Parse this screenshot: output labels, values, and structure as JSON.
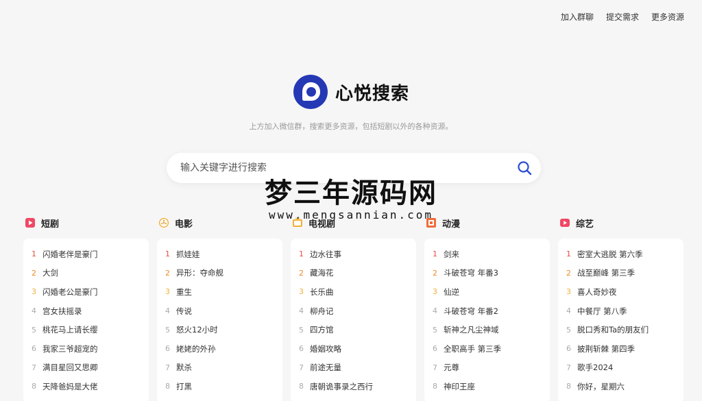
{
  "topnav": [
    "加入群聊",
    "提交需求",
    "更多资源"
  ],
  "logo": {
    "name": "心悦搜索",
    "color": "#2539b5"
  },
  "subtitle": "上方加入微信群，搜索更多资源，包括短剧以外的各种资源。",
  "search": {
    "placeholder": "输入关键字进行搜索",
    "icon": "search-icon",
    "icon_color": "#2b4bd4"
  },
  "watermark": {
    "main": "梦三年源码网",
    "url": "www.mengsannian.com"
  },
  "columns": [
    {
      "title": "短剧",
      "icon": "play-icon",
      "color": "#f04864",
      "items": [
        "闪婚老伴是豪门",
        "大剑",
        "闪婚老公是豪门",
        "宫女扶摇录",
        "桃花马上请长缨",
        "我家三爷超宠的",
        "满目星回又思卿",
        "天降爸妈是大佬"
      ]
    },
    {
      "title": "电影",
      "icon": "film-reel-icon",
      "color": "#f2b035",
      "items": [
        "抓娃娃",
        "异形：夺命舰",
        "重生",
        "传说",
        "怒火12小时",
        "姥姥的外孙",
        "默杀",
        "打黑"
      ]
    },
    {
      "title": "电视剧",
      "icon": "tv-icon",
      "color": "#f2b035",
      "items": [
        "边水往事",
        "藏海花",
        "长乐曲",
        "柳舟记",
        "四方馆",
        "婚姻攻略",
        "前途无量",
        "唐朝诡事录之西行"
      ]
    },
    {
      "title": "动漫",
      "icon": "anime-icon",
      "color": "#f26b3a",
      "items": [
        "剑来",
        "斗破苍穹 年番3",
        "仙逆",
        "斗破苍穹 年番2",
        "斩神之凡尘神域",
        "全职高手 第三季",
        "元尊",
        "神印王座"
      ]
    },
    {
      "title": "综艺",
      "icon": "variety-play-icon",
      "color": "#f04864",
      "items": [
        "密室大逃脱 第六季",
        "战至巅峰 第三季",
        "喜人奇妙夜",
        "中餐厅 第八季",
        "脱口秀和Ta的朋友们",
        "披荆斩棘 第四季",
        "歌手2024",
        "你好，星期六"
      ]
    }
  ]
}
